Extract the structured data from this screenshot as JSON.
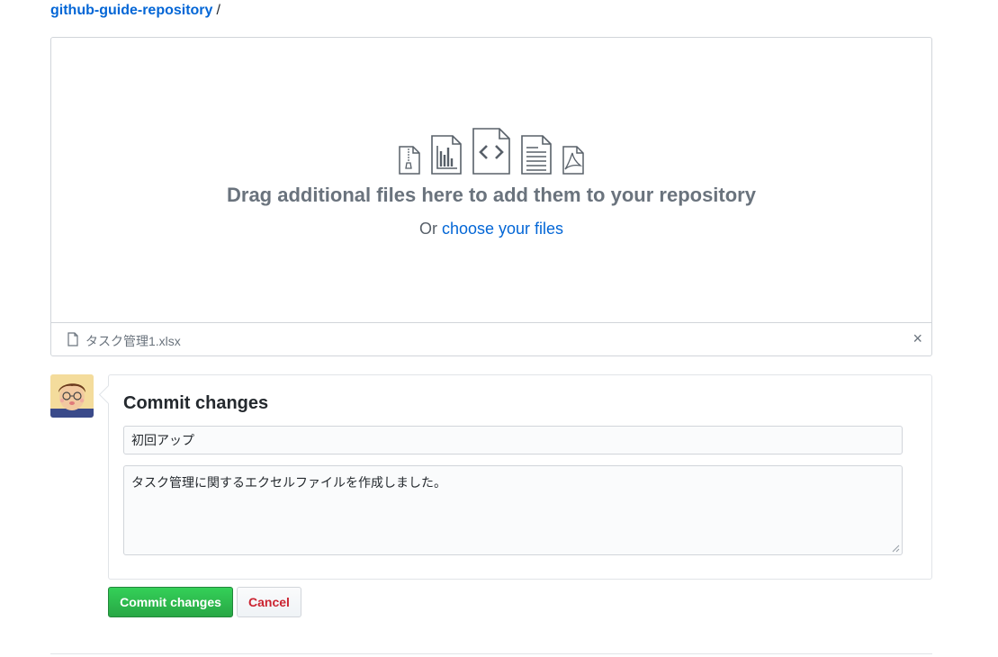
{
  "breadcrumb": {
    "repo": "github-guide-repository",
    "separator": "/"
  },
  "dropzone": {
    "icons": [
      "zip-file-icon",
      "chart-file-icon",
      "code-file-icon",
      "text-file-icon",
      "pdf-file-icon"
    ],
    "title": "Drag additional files here to add them to your repository",
    "prefix": "Or",
    "choose_link": "choose your files"
  },
  "upload": {
    "file_icon": "file-icon",
    "file_name": "タスク管理1.xlsx",
    "remove_label": "×"
  },
  "commit": {
    "avatar": "user-avatar",
    "title": "Commit changes",
    "summary_value": "初回アップ",
    "description_value": "タスク管理に関するエクセルファイルを作成しました。",
    "commit_button": "Commit changes",
    "cancel_button": "Cancel"
  },
  "colors": {
    "link": "#0366d6",
    "primary_button": "#28a745",
    "cancel_text": "#cb2431",
    "border": "#d1d5da"
  }
}
